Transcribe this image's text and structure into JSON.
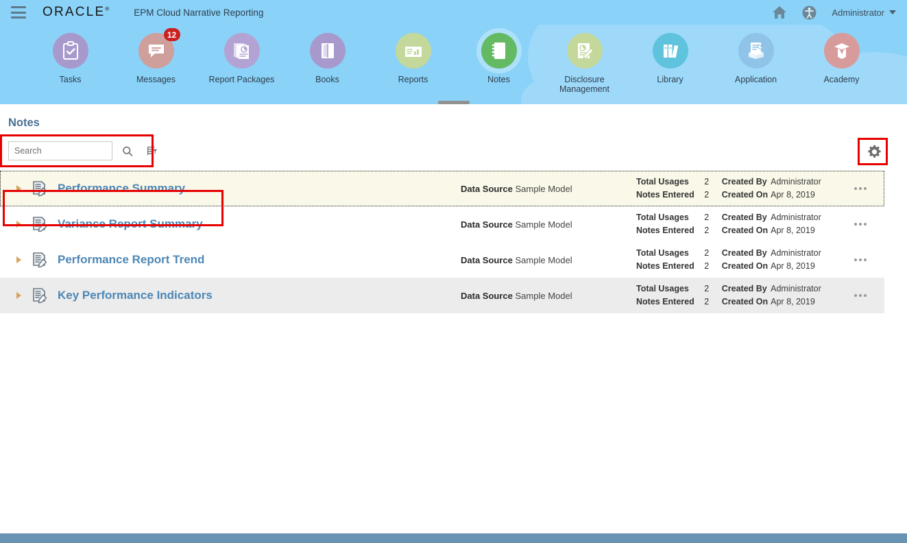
{
  "header": {
    "menu_icon": "hamburger-menu-icon",
    "logo_text": "ORACLE",
    "logo_tm": "®",
    "app_title": "EPM Cloud Narrative Reporting",
    "home_icon": "home-icon",
    "accessibility_icon": "accessibility-icon",
    "user_name": "Administrator",
    "user_caret": "chevron-down-icon"
  },
  "nav": {
    "items": [
      {
        "label": "Tasks",
        "icon": "clipboard-check-icon",
        "color": "#a899cd",
        "active": false,
        "badge": null
      },
      {
        "label": "Messages",
        "icon": "speech-bubble-icon",
        "color": "#cf9f9c",
        "active": false,
        "badge": "12"
      },
      {
        "label": "Report Packages",
        "icon": "stacked-reports-icon",
        "color": "#b3a3d4",
        "active": false,
        "badge": null
      },
      {
        "label": "Books",
        "icon": "book-icon",
        "color": "#a899cd",
        "active": false,
        "badge": null
      },
      {
        "label": "Reports",
        "icon": "report-chart-icon",
        "color": "#c3d89a",
        "active": false,
        "badge": null
      },
      {
        "label": "Notes",
        "icon": "notebook-icon",
        "color": "#63ba62",
        "active": true,
        "badge": null
      },
      {
        "label": "Disclosure Management",
        "icon": "disclosure-edit-icon",
        "color": "#c3d89a",
        "active": false,
        "badge": null
      },
      {
        "label": "Library",
        "icon": "library-books-icon",
        "color": "#5fc3dd",
        "active": false,
        "badge": null
      },
      {
        "label": "Application",
        "icon": "application-box-icon",
        "color": "#8fc4e8",
        "active": false,
        "badge": null
      },
      {
        "label": "Academy",
        "icon": "graduation-cap-icon",
        "color": "#d89b9b",
        "active": false,
        "badge": null
      }
    ],
    "collapse_handle": "collapse-handle"
  },
  "page": {
    "title": "Notes"
  },
  "search": {
    "placeholder": "Search",
    "value": "",
    "search_icon": "magnifier-icon",
    "filter_icon": "filter-list-icon"
  },
  "settings": {
    "gear_icon": "gear-icon"
  },
  "list": {
    "labels": {
      "data_source": "Data Source",
      "total_usages": "Total Usages",
      "notes_entered": "Notes Entered",
      "created_by": "Created By",
      "created_on": "Created On"
    },
    "rows": [
      {
        "name": "Performance Summary",
        "data_source": "Sample Model",
        "total_usages": "2",
        "notes_entered": "2",
        "created_by": "Administrator",
        "created_on": "Apr 8, 2019",
        "state": "state-focus"
      },
      {
        "name": "Variance Report Summary",
        "data_source": "Sample Model",
        "total_usages": "2",
        "notes_entered": "2",
        "created_by": "Administrator",
        "created_on": "Apr 8, 2019",
        "state": ""
      },
      {
        "name": "Performance Report Trend",
        "data_source": "Sample Model",
        "total_usages": "2",
        "notes_entered": "2",
        "created_by": "Administrator",
        "created_on": "Apr 8, 2019",
        "state": ""
      },
      {
        "name": "Key Performance Indicators",
        "data_source": "Sample Model",
        "total_usages": "2",
        "notes_entered": "2",
        "created_by": "Administrator",
        "created_on": "Apr 8, 2019",
        "state": "state-alt"
      }
    ]
  },
  "annotations": {
    "color": "#e60000",
    "boxes": [
      "search-area-highlight",
      "settings-gear-highlight",
      "first-note-row-highlight"
    ]
  },
  "colors": {
    "header_blue": "#8ad2f8",
    "cloud_blue": "#9ed9fa",
    "footer_blue": "#6993b3",
    "link_blue": "#4d87b5",
    "title_blue": "#4a6f92",
    "row_focus": "#faf8e8",
    "row_alt": "#ececec",
    "badge_red": "#cc1f1f",
    "annotation_red": "#e60000"
  }
}
